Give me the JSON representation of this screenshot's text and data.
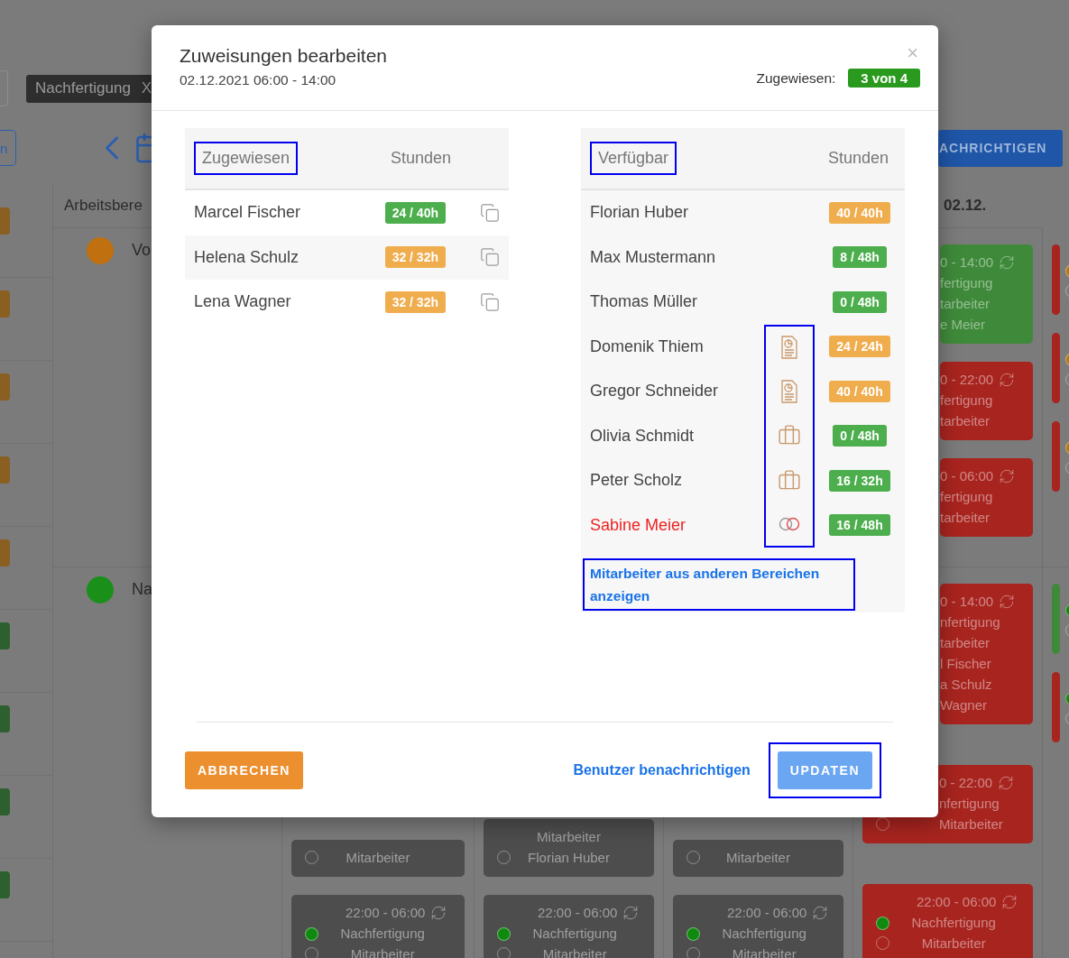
{
  "background": {
    "filter_tag": {
      "label": "Nachfertigung",
      "close": "X"
    },
    "today_button": "n",
    "notify_button": "ACHRICHTIGEN",
    "side_markers": [
      {
        "color": "#8a5f22"
      },
      {
        "color": "#8a5f22"
      },
      {
        "color": "#8a5f22"
      },
      {
        "color": "#8a5f22"
      },
      {
        "color": "#8a5f22"
      },
      {
        "color": "#2e5f2e"
      },
      {
        "color": "#2e5f2e"
      },
      {
        "color": "#2e5f2e"
      },
      {
        "color": "#2e5f2e"
      }
    ],
    "area_header": "Arbeitsbere",
    "day_header": "02.12.",
    "areas": [
      {
        "label": "Vo",
        "color": "#c0700f"
      },
      {
        "label": "Na",
        "color": "#1a8f1a"
      }
    ],
    "rows": [
      {
        "columns": [
          [],
          [],
          [],
          [
            {
              "color": "#3f8a3a",
              "time": "0 - 14:00",
              "lines": [
                "fertigung",
                "tarbeiter",
                "e Meier"
              ]
            },
            {
              "color": "#a8241f",
              "time": "0 - 22:00",
              "lines": [
                "fertigung",
                "tarbeiter"
              ]
            },
            {
              "color": "#a8241f",
              "time": "0 - 06:00",
              "lines": [
                "fertigung",
                "tarbeiter"
              ]
            }
          ],
          [
            {
              "color": "#a8241f",
              "markers": [
                {
                  "kind": "filled",
                  "color": "#b07a10"
                },
                {
                  "kind": "empty"
                }
              ]
            },
            {
              "color": "#a8241f",
              "markers": [
                {
                  "kind": "filled",
                  "color": "#b07a10"
                },
                {
                  "kind": "empty"
                }
              ]
            },
            {
              "color": "#a8241f",
              "markers": [
                {
                  "kind": "filled",
                  "color": "#b07a10"
                },
                {
                  "kind": "empty"
                }
              ]
            }
          ]
        ]
      },
      {
        "columns": [
          [
            {
              "color": "#4d4d4d",
              "lines": [
                "Mitarbeiter"
              ],
              "markers": [
                {
                  "kind": "empty"
                }
              ]
            },
            {
              "color": "#4d4d4d",
              "time": "22:00 - 06:00",
              "lines": [
                "Nachfertigung",
                "Mitarbeiter"
              ],
              "markers": [
                {
                  "kind": "filled",
                  "color": "#0f8a0f"
                },
                {
                  "kind": "empty"
                }
              ]
            }
          ],
          [
            {
              "color": "#4d4d4d",
              "lines": [
                "Mitarbeiter",
                "Florian Huber"
              ],
              "markers": [
                {
                  "kind": "empty"
                }
              ]
            },
            {
              "color": "#4d4d4d",
              "time": "22:00 - 06:00",
              "lines": [
                "Nachfertigung",
                "Mitarbeiter"
              ],
              "markers": [
                {
                  "kind": "filled",
                  "color": "#0f8a0f"
                },
                {
                  "kind": "empty"
                }
              ]
            }
          ],
          [
            {
              "color": "#4d4d4d",
              "lines": [
                "Mitarbeiter"
              ],
              "markers": [
                {
                  "kind": "empty"
                }
              ]
            },
            {
              "color": "#4d4d4d",
              "time": "22:00 - 06:00",
              "lines": [
                "Nachfertigung",
                "Mitarbeiter"
              ],
              "markers": [
                {
                  "kind": "filled",
                  "color": "#0f8a0f"
                },
                {
                  "kind": "empty"
                }
              ]
            }
          ],
          [
            {
              "color": "#a8241f",
              "time": "0 - 14:00",
              "lines": [
                "nfertigung",
                "tarbeiter",
                "l Fischer",
                "a Schulz",
                "Wagner"
              ]
            },
            {
              "color": "#a8241f",
              "time": "0 - 22:00",
              "lines": [
                "nfertigung",
                "Mitarbeiter"
              ],
              "markers": [
                {
                  "kind": "empty"
                }
              ]
            },
            {
              "color": "#a8241f",
              "time": "22:00 - 06:00",
              "lines": [
                "Nachfertigung",
                "Mitarbeiter"
              ],
              "markers": [
                {
                  "kind": "filled",
                  "color": "#0f8a0f"
                },
                {
                  "kind": "empty"
                }
              ]
            }
          ],
          [
            {
              "color": "#3f8a3a",
              "markers": [
                {
                  "kind": "filled",
                  "color": "#0f8a0f"
                },
                {
                  "kind": "empty"
                }
              ]
            },
            {
              "color": "#a8241f",
              "markers": [
                {
                  "kind": "filled",
                  "color": "#0f8a0f"
                },
                {
                  "kind": "empty"
                }
              ]
            }
          ]
        ]
      }
    ]
  },
  "dialog": {
    "title": "Zuweisungen bearbeiten",
    "subtitle": "02.12.2021 06:00 - 14:00",
    "close": "×",
    "assigned_label": "Zugewiesen:",
    "assigned_count": "3 von 4",
    "assigned": {
      "heading": "Zugewiesen",
      "heading_highlighted": true,
      "hours_heading": "Stunden",
      "rows": [
        {
          "name": "Marcel Fischer",
          "hours": "24 / 40h",
          "color": "#4cae4c"
        },
        {
          "name": "Helena Schulz",
          "hours": "32 / 32h",
          "color": "#f0ad4e"
        },
        {
          "name": "Lena Wagner",
          "hours": "32 / 32h",
          "color": "#f0ad4e"
        }
      ]
    },
    "available": {
      "heading": "Verfügbar",
      "heading_highlighted": true,
      "hours_heading": "Stunden",
      "icons_highlighted": true,
      "rows": [
        {
          "name": "Florian Huber",
          "kind": "plain",
          "hours": "40 / 40h",
          "color": "#f0ad4e",
          "conflict": false
        },
        {
          "name": "Max Mustermann",
          "kind": "plain",
          "hours": "8 / 48h",
          "color": "#4cae4c",
          "conflict": false
        },
        {
          "name": "Thomas Müller",
          "kind": "plain",
          "hours": "0 / 48h",
          "color": "#4cae4c",
          "conflict": false
        },
        {
          "name": "Domenik Thiem",
          "kind": "document",
          "hours": "24 / 24h",
          "color": "#f0ad4e",
          "conflict": false
        },
        {
          "name": "Gregor Schneider",
          "kind": "document",
          "hours": "40 / 40h",
          "color": "#f0ad4e",
          "conflict": false
        },
        {
          "name": "Olivia Schmidt",
          "kind": "briefcase",
          "hours": "0 / 48h",
          "color": "#4cae4c",
          "conflict": false
        },
        {
          "name": "Peter Scholz",
          "kind": "briefcase",
          "hours": "16 / 32h",
          "color": "#4cae4c",
          "conflict": false
        },
        {
          "name": "Sabine Meier",
          "kind": "rings",
          "hours": "16 / 48h",
          "color": "#4cae4c",
          "conflict": true
        }
      ],
      "more_link": "Mitarbeiter aus anderen Bereichen anzeigen",
      "more_link_highlighted": true
    },
    "cancel_button": "ABBRECHEN",
    "notify_link": "Benutzer benachrichtigen",
    "update_button": "UPDATEN",
    "update_highlighted": true
  }
}
